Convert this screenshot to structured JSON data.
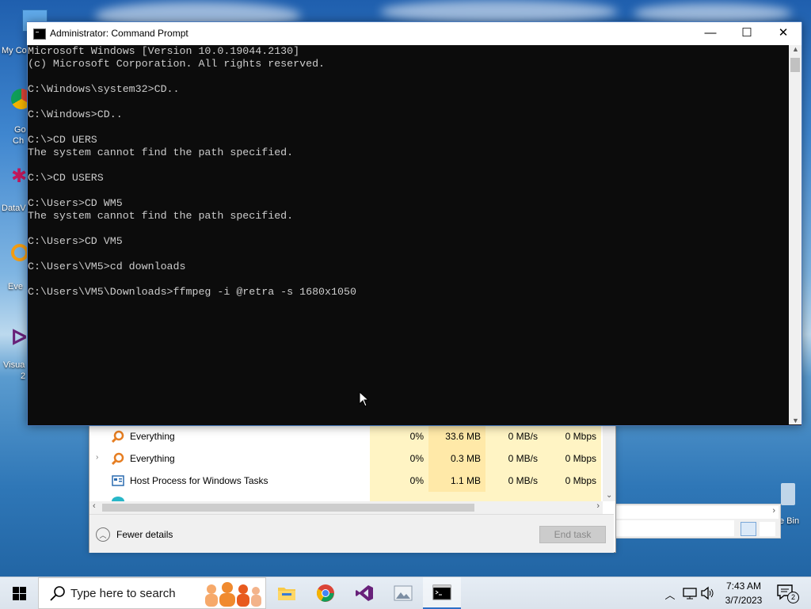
{
  "desktop": {
    "icons": [
      {
        "label": "My Co"
      },
      {
        "label": "Go"
      },
      {
        "label": "Ch"
      },
      {
        "label": "DataV"
      },
      {
        "label": "Eve"
      },
      {
        "label": "Visua"
      },
      {
        "label": "2"
      }
    ],
    "recycle_bin_label": "e Bin"
  },
  "cmd": {
    "title": "Administrator: Command Prompt",
    "lines": [
      "Microsoft Windows [Version 10.0.19044.2130]",
      "(c) Microsoft Corporation. All rights reserved.",
      "",
      "C:\\Windows\\system32>CD..",
      "",
      "C:\\Windows>CD..",
      "",
      "C:\\>CD UERS",
      "The system cannot find the path specified.",
      "",
      "C:\\>CD USERS",
      "",
      "C:\\Users>CD WM5",
      "The system cannot find the path specified.",
      "",
      "C:\\Users>CD VM5",
      "",
      "C:\\Users\\VM5>cd downloads",
      "",
      "C:\\Users\\VM5\\Downloads>ffmpeg -i @retra -s 1680x1050"
    ],
    "minimize": "—",
    "maximize": "☐",
    "close": "✕"
  },
  "taskmgr": {
    "rows": [
      {
        "name": "Everything",
        "cpu": "0%",
        "memory": "33.6 MB",
        "disk": "0 MB/s",
        "network": "0 Mbps",
        "expandable": false
      },
      {
        "name": "Everything",
        "cpu": "0%",
        "memory": "0.3 MB",
        "disk": "0 MB/s",
        "network": "0 Mbps",
        "expandable": true
      },
      {
        "name": "Host Process for Windows Tasks",
        "cpu": "0%",
        "memory": "1.1 MB",
        "disk": "0 MB/s",
        "network": "0 Mbps",
        "expandable": false
      }
    ],
    "fewer_details": "Fewer details",
    "end_task": "End task"
  },
  "taskbar": {
    "search_placeholder": "Type here to search",
    "apps": [
      "file-explorer",
      "chrome",
      "visual-studio",
      "photos",
      "command-prompt"
    ],
    "time": "7:43 AM",
    "date": "3/7/2023",
    "notification_count": "2"
  },
  "colors": {
    "console_bg": "#0c0c0c",
    "console_fg": "#cccccc",
    "taskbar_bg": "#dfe7f0",
    "accent": "#2c6fc7"
  }
}
